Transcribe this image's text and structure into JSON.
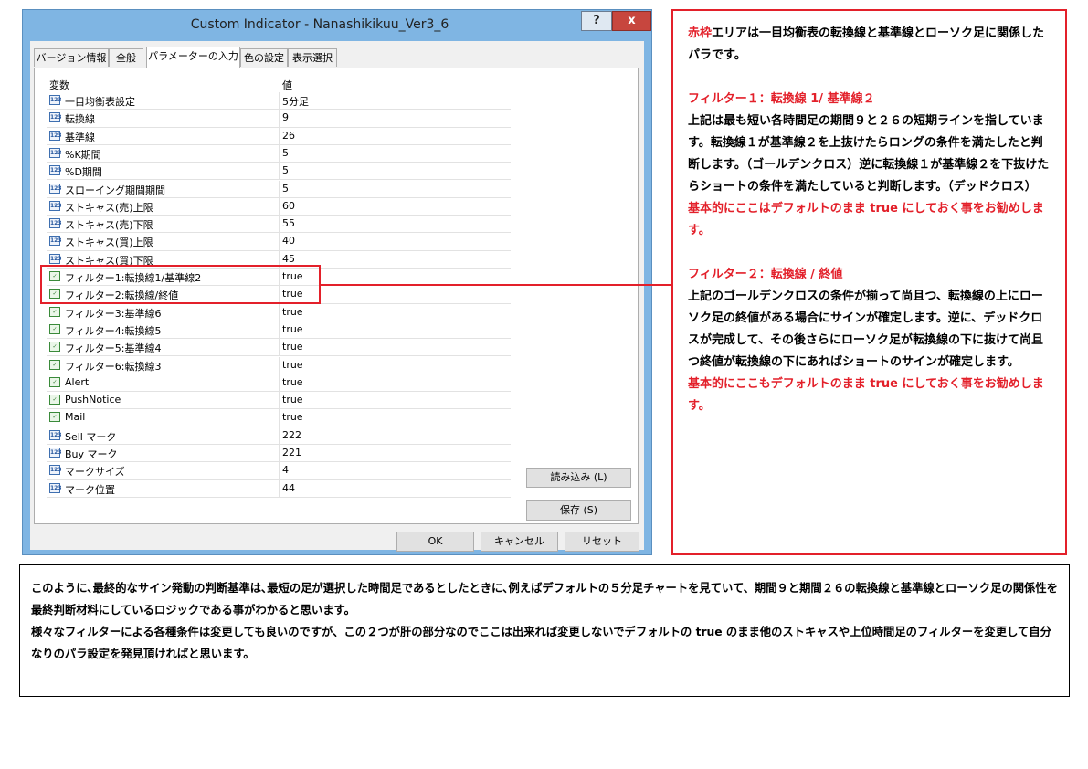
{
  "window": {
    "title": "Custom Indicator - Nanashikikuu_Ver3_6",
    "help_label": "?",
    "close_label": "x"
  },
  "tabs": [
    {
      "label": "バージョン情報"
    },
    {
      "label": "全般"
    },
    {
      "label": "パラメーターの入力",
      "active": true
    },
    {
      "label": "色の設定"
    },
    {
      "label": "表示選択"
    }
  ],
  "grid": {
    "col_variable": "変数",
    "col_value": "値",
    "rows": [
      {
        "icon": "numeric-icon",
        "name": "一目均衡表設定",
        "value": "5分足"
      },
      {
        "icon": "numeric-icon",
        "name": "転換線",
        "value": "9"
      },
      {
        "icon": "numeric-icon",
        "name": "基準線",
        "value": "26"
      },
      {
        "icon": "numeric-icon",
        "name": "%K期間",
        "value": "5"
      },
      {
        "icon": "numeric-icon",
        "name": "%D期間",
        "value": "5"
      },
      {
        "icon": "numeric-icon",
        "name": "スローイング期間期間",
        "value": "5"
      },
      {
        "icon": "numeric-icon",
        "name": "ストキャス(売)上限",
        "value": "60"
      },
      {
        "icon": "numeric-icon",
        "name": "ストキャス(売)下限",
        "value": "55"
      },
      {
        "icon": "numeric-icon",
        "name": "ストキャス(買)上限",
        "value": "40"
      },
      {
        "icon": "numeric-icon",
        "name": "ストキャス(買)下限",
        "value": "45"
      },
      {
        "icon": "boolean-icon",
        "name": "フィルター1:転換線1/基準線2",
        "value": "true"
      },
      {
        "icon": "boolean-icon",
        "name": "フィルター2:転換線/終値",
        "value": "true"
      },
      {
        "icon": "boolean-icon",
        "name": "フィルター3:基準線6",
        "value": "true"
      },
      {
        "icon": "boolean-icon",
        "name": "フィルター4:転換線5",
        "value": "true"
      },
      {
        "icon": "boolean-icon",
        "name": "フィルター5:基準線4",
        "value": "true"
      },
      {
        "icon": "boolean-icon",
        "name": "フィルター6:転換線3",
        "value": "true"
      },
      {
        "icon": "boolean-icon",
        "name": "Alert",
        "value": "true"
      },
      {
        "icon": "boolean-icon",
        "name": "PushNotice",
        "value": "true"
      },
      {
        "icon": "boolean-icon",
        "name": "Mail",
        "value": "true"
      },
      {
        "icon": "numeric-icon",
        "name": "Sell マーク",
        "value": "222"
      },
      {
        "icon": "numeric-icon",
        "name": "Buy マーク",
        "value": "221"
      },
      {
        "icon": "numeric-icon",
        "name": "マークサイズ",
        "value": "4"
      },
      {
        "icon": "numeric-icon",
        "name": "マーク位置",
        "value": "44"
      }
    ]
  },
  "buttons": {
    "load": "読み込み (L)",
    "save": "保存 (S)",
    "ok": "OK",
    "cancel": "キャンセル",
    "reset": "リセット"
  },
  "note_right": {
    "intro_red": "赤枠",
    "intro_rest": "エリアは一目均衡表の転換線と基準線とローソク足に関係したパラです。",
    "filter1_title": "フィルター１：転換線 1/ 基準線２",
    "filter1_body": "上記は最も短い各時間足の期間９と２６の短期ラインを指しています。転換線１が基準線２を上抜けたらロングの条件を満たしたと判断します。（ゴールデンクロス）逆に転換線１が基準線２を下抜けたらショートの条件を満たしていると判断します。（デッドクロス）",
    "filter1_recommend": "基本的にここはデフォルトのまま true にしておく事をお勧めします。",
    "filter2_title": "フィルター２：転換線 / 終値",
    "filter2_body": "上記のゴールデンクロスの条件が揃って尚且つ、転換線の上にローソク足の終値がある場合にサインが確定します。逆に、デッドクロスが完成して、その後さらにローソク足が転換線の下に抜けて尚且つ終値が転換線の下にあればショートのサインが確定します。",
    "filter2_recommend": "基本的にここもデフォルトのまま true にしておく事をお勧めします。"
  },
  "note_bottom": {
    "para1": "このように､最終的なサイン発動の判断基準は､最短の足が選択した時間足であるとしたときに､例えばデフォルトの５分足チャートを見ていて、期間９と期間２６の転換線と基準線とローソク足の関係性を最終判断材料にしているロジックである事がわかると思います。",
    "para2": "様々なフィルターによる各種条件は変更しても良いのですが、この２つが肝の部分なのでここは出来れば変更しないでデフォルトの true のまま他のストキャスや上位時間足のフィルターを変更して自分なりのパラ設定を発見頂ければと思います。"
  },
  "colors": {
    "highlight": "#e3202a",
    "titlebar": "#7fb5e3",
    "close_button": "#c7463e"
  }
}
